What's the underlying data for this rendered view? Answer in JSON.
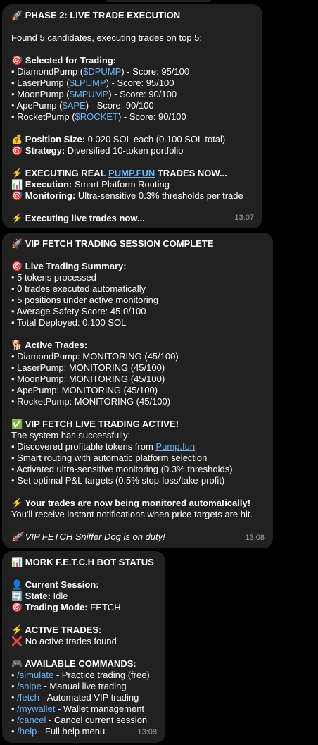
{
  "m1": {
    "title": "🚀 PHASE 2: LIVE TRADE EXECUTION",
    "intro": "Found 5 candidates, executing trades on top 5:",
    "selected_label": "🎯 Selected for Trading:",
    "candidates": [
      {
        "name": "• DiamondPump (",
        "ticker": "$DPUMP",
        "score": ") - Score: 95/100"
      },
      {
        "name": "• LaserPump (",
        "ticker": "$LPUMP",
        "score": ") - Score: 95/100"
      },
      {
        "name": "• MoonPump (",
        "ticker": "$MPUMP",
        "score": ") - Score: 90/100"
      },
      {
        "name": "• ApePump (",
        "ticker": "$APE",
        "score": ") - Score: 90/100"
      },
      {
        "name": "• RocketPump (",
        "ticker": "$ROCKET",
        "score": ") - Score: 90/100"
      }
    ],
    "position_label": "💰 Position Size:",
    "position_value": " 0.020 SOL each (0.100 SOL total)",
    "strategy_label": "🎯 Strategy:",
    "strategy_value": " Diversified 10-token portfolio",
    "exec_pre": "⚡ EXECUTING REAL ",
    "exec_link": "PUMP.FUN",
    "exec_post": " TRADES NOW...",
    "execution_label": "📊 Execution:",
    "execution_value": " Smart Platform Routing",
    "monitoring_label": "🎯 Monitoring:",
    "monitoring_value": " Ultra-sensitive 0.3% thresholds per trade",
    "footer": "⚡ Executing live trades now...",
    "time": "13:07"
  },
  "m2": {
    "title": "🚀 VIP FETCH TRADING SESSION COMPLETE",
    "summary_label": "🎯 Live Trading Summary:",
    "summary": [
      "• 5 tokens processed",
      "• 0 trades executed automatically",
      "• 5 positions under active monitoring",
      "• Average Safety Score: 45.0/100",
      "• Total Deployed: 0.100 SOL"
    ],
    "active_label": "🐕 Active Trades:",
    "active": [
      "• DiamondPump: MONITORING (45/100)",
      "• LaserPump: MONITORING (45/100)",
      "• MoonPump: MONITORING (45/100)",
      "• ApePump: MONITORING (45/100)",
      "• RocketPump: MONITORING (45/100)"
    ],
    "vip_label": "✅ VIP FETCH LIVE TRADING ACTIVE!",
    "system": "The system has successfully:",
    "discovered_pre": "• Discovered profitable tokens from ",
    "discovered_link": "Pump.fun",
    "steps": [
      "• Smart routing with automatic platform selection",
      "• Activated ultra-sensitive monitoring (0.3% thresholds)",
      "• Set optimal P&L targets (0.5% stop-loss/take-profit)"
    ],
    "monitored_label": "⚡ Your trades are now being monitored automatically!",
    "notify": "You'll receive instant notifications when price targets are hit.",
    "footer": "🚀 VIP FETCH Sniffer Dog is on duty!",
    "time": "13:08"
  },
  "m3": {
    "title": "📊 MORK F.E.T.C.H BOT STATUS",
    "session_label": "👤 Current Session:",
    "state_label": "🔄 State:",
    "state_value": " Idle",
    "mode_label": "🎯 Trading Mode:",
    "mode_value": " FETCH",
    "active_label": "⚡ ACTIVE TRADES:",
    "no_trades": "❌ No active trades found",
    "commands_label": "🎮 AVAILABLE COMMANDS:",
    "commands": [
      {
        "cmd": "/simulate",
        "desc": " - Practice trading (free)"
      },
      {
        "cmd": "/snipe",
        "desc": " - Manual live trading"
      },
      {
        "cmd": "/fetch",
        "desc": " - Automated VIP trading"
      },
      {
        "cmd": "/mywallet",
        "desc": " - Wallet management"
      },
      {
        "cmd": "/cancel",
        "desc": " - Cancel current session"
      },
      {
        "cmd": "/help",
        "desc": " - Full help menu"
      }
    ],
    "time": "13:08"
  }
}
